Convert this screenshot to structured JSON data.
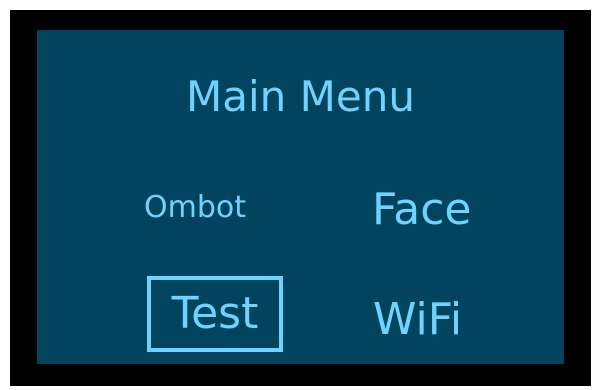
{
  "menu": {
    "title": "Main Menu",
    "items": [
      {
        "label": "Ombot"
      },
      {
        "label": "Face"
      },
      {
        "label": "Test",
        "selected": true
      },
      {
        "label": "WiFi"
      }
    ]
  },
  "colors": {
    "bezel": "#000000",
    "screen": "#02445e",
    "text": "#6fd2ff",
    "selection": "#6fd2ff"
  }
}
